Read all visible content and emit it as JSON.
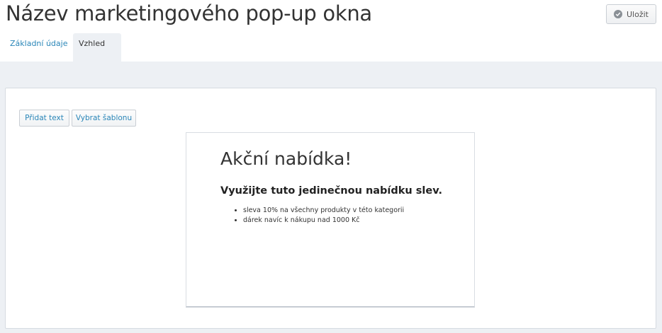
{
  "header": {
    "title": "Název marketingového pop-up okna",
    "save_label": "Uložit"
  },
  "tabs": [
    {
      "label": "Základní údaje",
      "active": false
    },
    {
      "label": "Vzhled",
      "active": true
    }
  ],
  "toolbar": {
    "add_text_label": "Přidat text",
    "choose_template_label": "Vybrat šablonu"
  },
  "popup": {
    "heading": "Akční nabídka!",
    "subheading": "Využijte tuto jedinečnou nabídku slev.",
    "items": [
      "sleva 10% na všechny produkty v této kategorii",
      "dárek navíc k nákupu nad 1000 Kč"
    ]
  },
  "colors": {
    "accent": "#2a86b8",
    "background": "#edf0f4",
    "panel": "#ffffff"
  },
  "icons": {
    "save": "check-circle-icon"
  }
}
